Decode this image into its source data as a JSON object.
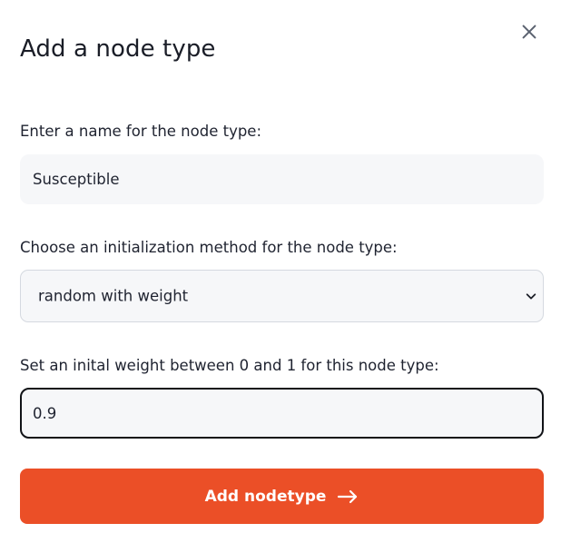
{
  "dialog": {
    "title": "Add a node type",
    "close_icon": "close-icon"
  },
  "form": {
    "name_label": "Enter a name for the node type:",
    "name_value": "Susceptible",
    "method_label": "Choose an initialization method for the node type:",
    "method_selected": "random with weight",
    "method_icon": "chevron-down-icon",
    "weight_label": "Set an inital weight between 0 and 1 for this node type:",
    "weight_value": "0.9"
  },
  "actions": {
    "submit_label": "Add nodetype",
    "submit_icon": "arrow-right-icon"
  },
  "colors": {
    "accent": "#eb4f27",
    "field_bg": "#f6f7f9",
    "text": "#1f2330"
  }
}
